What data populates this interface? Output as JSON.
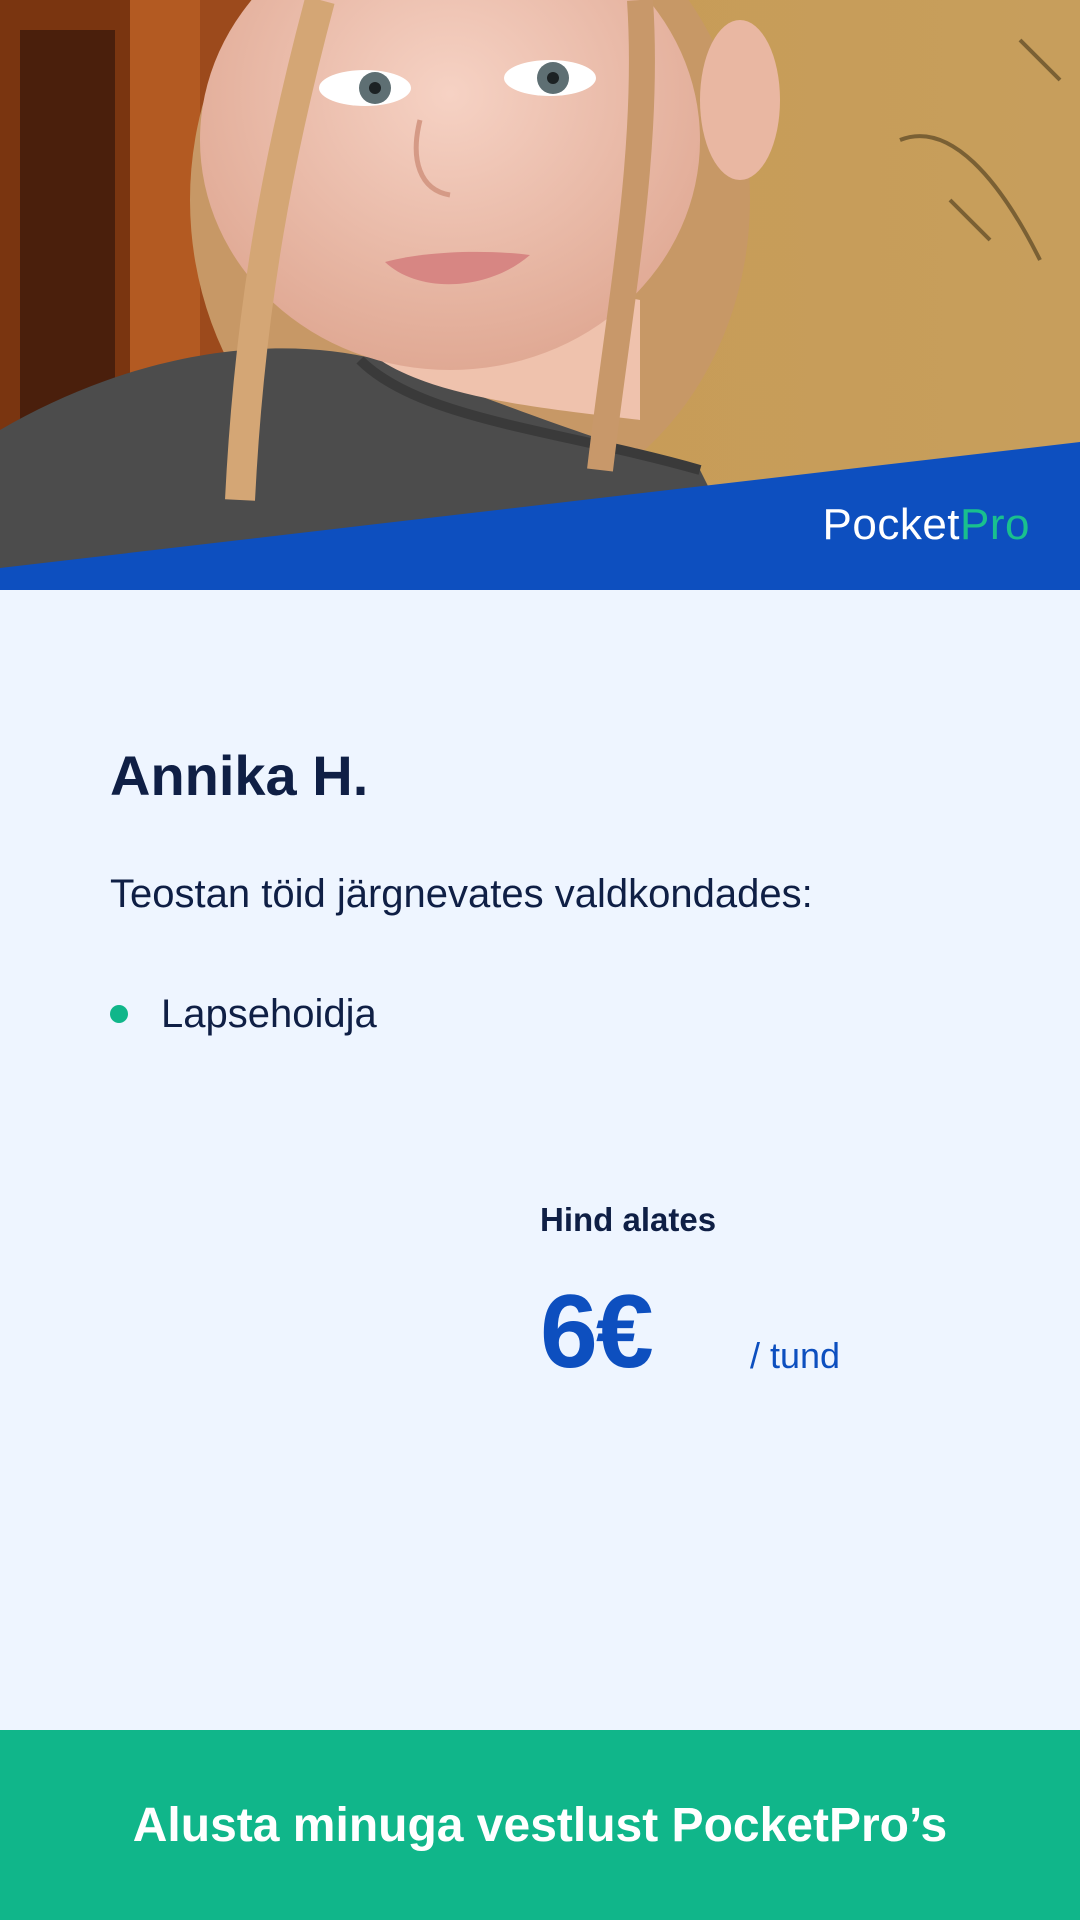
{
  "brand": {
    "logo_part1": "Pocket",
    "logo_part2": "Pro"
  },
  "profile": {
    "name": "Annika H.",
    "intro": "Teostan töid järgnevates valdkondades:",
    "skills": [
      "Lapsehoidja"
    ]
  },
  "price": {
    "label": "Hind alates",
    "value": "6€",
    "unit": "/ tund"
  },
  "cta": {
    "label": "Alusta minuga vestlust PocketPro’s"
  },
  "colors": {
    "brand_blue": "#0d4fbf",
    "brand_green": "#10b68a",
    "background": "#eef5ff",
    "text_dark": "#0f1f45"
  }
}
